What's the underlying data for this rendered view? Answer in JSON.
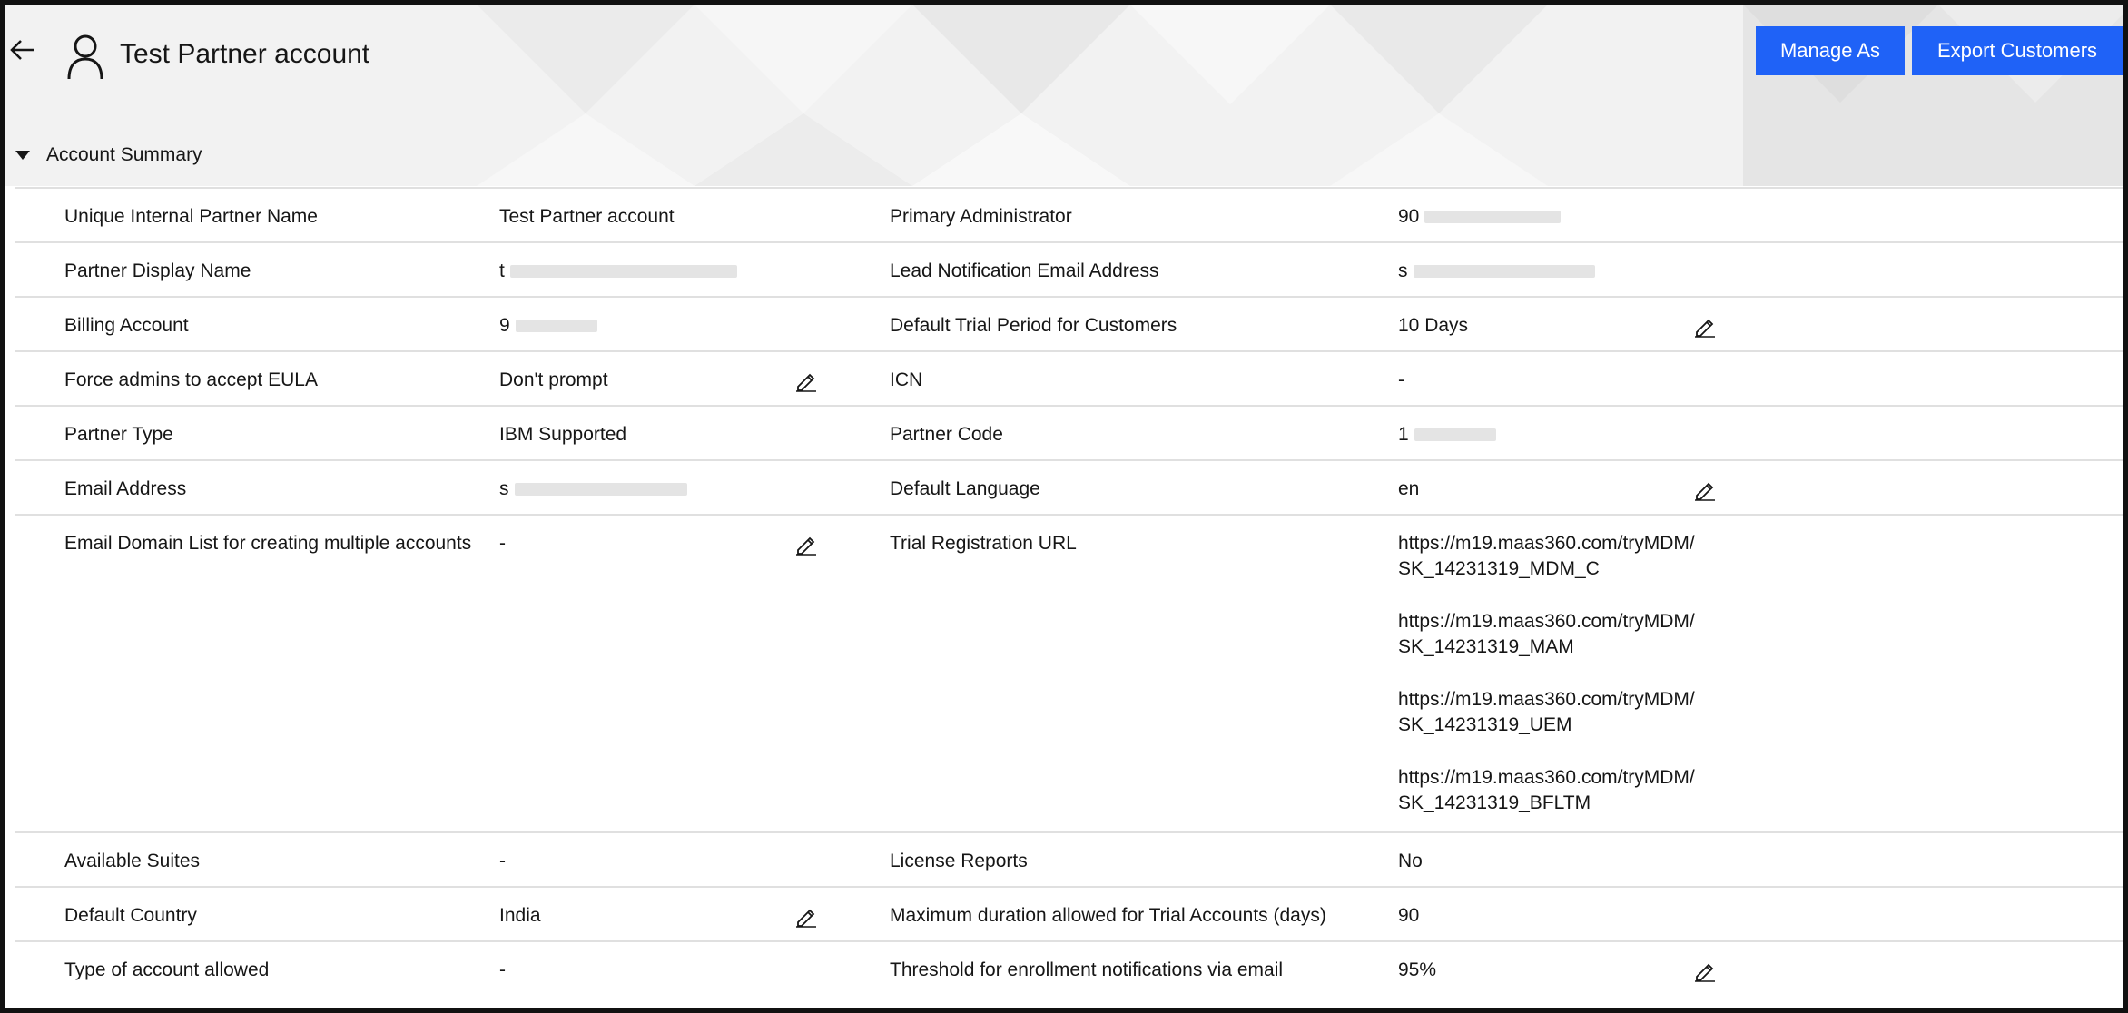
{
  "header": {
    "title": "Test Partner account",
    "back_icon": "arrow-left-icon",
    "avatar_icon": "user-icon",
    "buttons": {
      "manage_as": "Manage As",
      "export_customers": "Export Customers"
    }
  },
  "colors": {
    "primary_button": "#1f62f7",
    "background": "#f2f2f2",
    "divider": "#e0e0e0"
  },
  "section": {
    "label": "Account Summary",
    "expanded": true
  },
  "rows": [
    {
      "label1": "Unique Internal Partner Name",
      "value1": "Test Partner account",
      "label2": "Primary Administrator",
      "value2": "90"
    },
    {
      "label1": "Partner Display Name",
      "value1": "t",
      "label2": "Lead Notification Email Address",
      "value2": "s"
    },
    {
      "label1": "Billing Account",
      "value1": "9",
      "label2": "Default Trial Period for Customers",
      "value2": "10 Days"
    },
    {
      "label1": "Force admins to accept EULA",
      "value1": "Don't prompt",
      "label2": "ICN",
      "value2": "-"
    },
    {
      "label1": "Partner Type",
      "value1": "IBM Supported",
      "label2": "Partner Code",
      "value2": "1"
    },
    {
      "label1": "Email Address",
      "value1": "s",
      "label2": "Default Language",
      "value2": "en"
    },
    {
      "label1": "Email Domain List for creating multiple accounts",
      "value1": "-",
      "label2": "Trial Registration URL",
      "urls": [
        "https://m19.maas360.com/tryMDM/SK_14231319_MDM_C",
        "https://m19.maas360.com/tryMDM/SK_14231319_MAM",
        "https://m19.maas360.com/tryMDM/SK_14231319_UEM",
        "https://m19.maas360.com/tryMDM/SK_14231319_BFLTM"
      ]
    },
    {
      "label1": "Available Suites",
      "value1": "-",
      "label2": "License Reports",
      "value2": "No"
    },
    {
      "label1": "Default Country",
      "value1": "India",
      "label2": "Maximum duration allowed for Trial Accounts (days)",
      "value2": "90"
    },
    {
      "label1": "Type of account allowed",
      "value1": "-",
      "label2": "Threshold for enrollment notifications via email",
      "value2": "95%"
    }
  ],
  "edit_icon": "pencil-icon"
}
